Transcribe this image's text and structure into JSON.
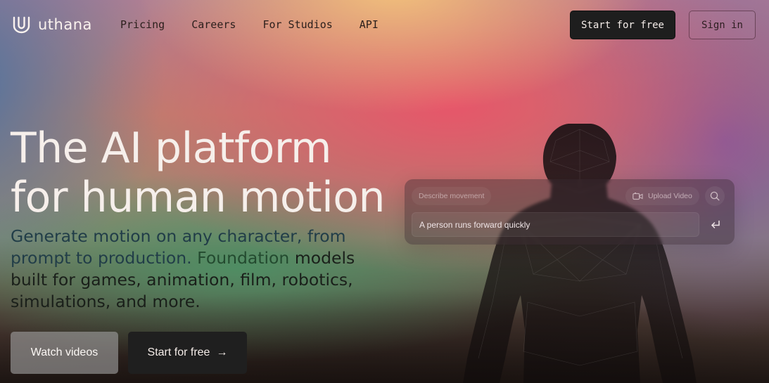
{
  "nav": {
    "brand": "uthana",
    "links": [
      "Pricing",
      "Careers",
      "For Studios",
      "API"
    ],
    "start_label": "Start for free",
    "signin_label": "Sign in"
  },
  "hero": {
    "title_line1": "The AI platform",
    "title_line2": "for human motion",
    "subtitle": {
      "part1": "Generate motion on any character, from prompt to production.",
      "part2": "Foundation",
      "part3": "models built for games, animation, film,",
      "part4": "robotics, simulations, and more."
    },
    "watch_label": "Watch videos",
    "start_label": "Start for free",
    "start_arrow": "→"
  },
  "prompt_panel": {
    "describe_label": "Describe movement",
    "upload_label": "Upload Video",
    "input_value": "A person runs forward quickly",
    "icons": [
      "video-camera-icon",
      "search-icon",
      "enter-icon"
    ]
  },
  "colors": {
    "button_dark": "#1e1e1e",
    "title_text": "#f6efeb"
  }
}
